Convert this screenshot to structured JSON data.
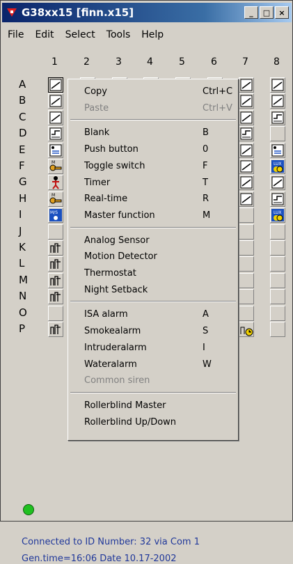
{
  "window": {
    "title": "G38xx15 [finn.x15]",
    "minimize": "_",
    "maximize": "□",
    "close": "×"
  },
  "menubar": [
    "File",
    "Edit",
    "Select",
    "Tools",
    "Help"
  ],
  "grid": {
    "columns": [
      "1",
      "2",
      "3",
      "4",
      "5",
      "6",
      "7",
      "8"
    ],
    "rows": [
      "A",
      "B",
      "C",
      "D",
      "E",
      "F",
      "G",
      "H",
      "I",
      "J",
      "K",
      "L",
      "M",
      "N",
      "O",
      "P"
    ]
  },
  "context_menu": {
    "items": [
      {
        "label": "Copy",
        "shortcut": "Ctrl+C",
        "enabled": true
      },
      {
        "label": "Paste",
        "shortcut": "Ctrl+V",
        "enabled": false
      },
      {
        "label": "Blank",
        "shortcut": "B",
        "enabled": true
      },
      {
        "label": "Push button",
        "shortcut": "0",
        "enabled": true
      },
      {
        "label": "Toggle switch",
        "shortcut": "F",
        "enabled": true
      },
      {
        "label": "Timer",
        "shortcut": "T",
        "enabled": true
      },
      {
        "label": "Real-time",
        "shortcut": "R",
        "enabled": true
      },
      {
        "label": "Master function",
        "shortcut": "M",
        "enabled": true
      },
      {
        "label": "Analog Sensor",
        "shortcut": "",
        "enabled": true
      },
      {
        "label": "Motion Detector",
        "shortcut": "",
        "enabled": true
      },
      {
        "label": "Thermostat",
        "shortcut": "",
        "enabled": true
      },
      {
        "label": "Night Setback",
        "shortcut": "",
        "enabled": true
      },
      {
        "label": "ISA alarm",
        "shortcut": "A",
        "enabled": true
      },
      {
        "label": "Smokealarm",
        "shortcut": "S",
        "enabled": true
      },
      {
        "label": "Intruderalarm",
        "shortcut": "I",
        "enabled": true
      },
      {
        "label": "Wateralarm",
        "shortcut": "W",
        "enabled": true
      },
      {
        "label": "Common siren",
        "shortcut": "",
        "enabled": false
      },
      {
        "label": "Rollerblind Master",
        "shortcut": "",
        "enabled": true
      },
      {
        "label": "Rollerblind Up/Down",
        "shortcut": "",
        "enabled": true
      }
    ]
  },
  "status": {
    "connection": "Connected to ID Number:  32  via Com  1",
    "gen_time": "Gen.time=16:06  Date  10.17-2002"
  },
  "colors": {
    "title_start": "#0a246a",
    "title_end": "#a6caf0",
    "status_text": "#20389a",
    "led": "#20c020"
  }
}
